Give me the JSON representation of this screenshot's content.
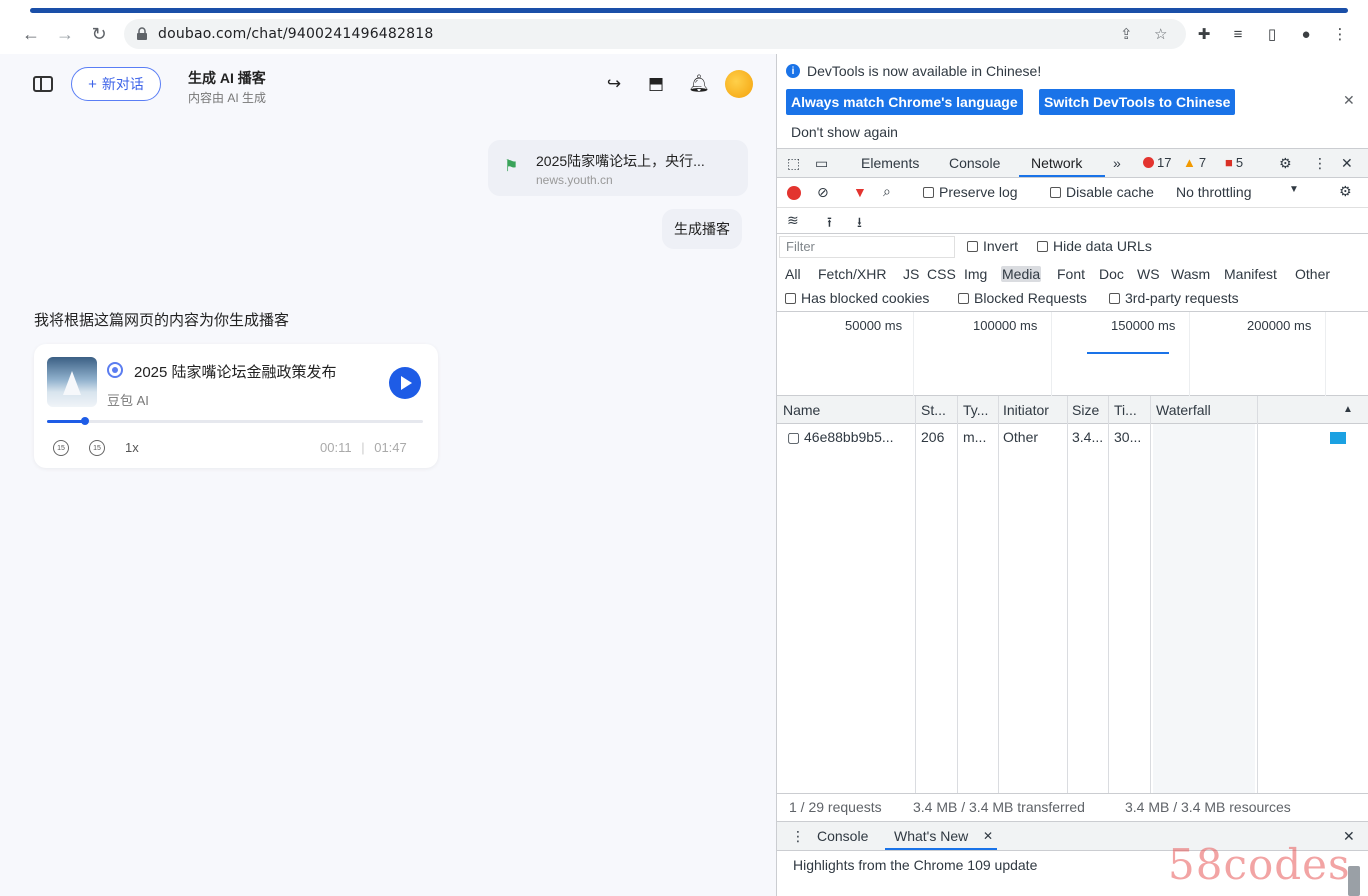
{
  "browser": {
    "url": "doubao.com/chat/9400241496482818",
    "back_label": "←",
    "forward_label": "→",
    "reload_label": "↻"
  },
  "page": {
    "new_chat_label": "新对话",
    "title": "生成 AI 播客",
    "subtitle": "内容由 AI 生成",
    "link_card": {
      "title": "2025陆家嘴论坛上，央行...",
      "source": "news.youth.cn"
    },
    "user_message": "生成播客",
    "ai_reply": "我将根据这篇网页的内容为你生成播客",
    "podcast": {
      "title": "2025 陆家嘴论坛金融政策发布",
      "author": "豆包 AI",
      "speed": "1x",
      "current_time": "00:11",
      "separator": "|",
      "duration": "01:47",
      "progress_fraction": 0.1
    }
  },
  "devtools": {
    "info_message": "DevTools is now available in Chinese!",
    "btn_match_language": "Always match Chrome's language",
    "btn_switch": "Switch DevTools to Chinese",
    "dont_show": "Don't show again",
    "tabs": [
      "Elements",
      "Console",
      "Network",
      "»"
    ],
    "active_tab": "Network",
    "errors": "17",
    "warnings": "7",
    "issues": "5",
    "preserve_log": "Preserve log",
    "disable_cache": "Disable cache",
    "throttling": "No throttling",
    "filter_placeholder": "Filter",
    "invert": "Invert",
    "hide_data_urls": "Hide data URLs",
    "types": [
      "All",
      "Fetch/XHR",
      "JS",
      "CSS",
      "Img",
      "Media",
      "Font",
      "Doc",
      "WS",
      "Wasm",
      "Manifest",
      "Other"
    ],
    "selected_type": "Media",
    "has_blocked_cookies": "Has blocked cookies",
    "blocked_requests": "Blocked Requests",
    "third_party": "3rd-party requests",
    "timeline_ticks": [
      "50000 ms",
      "100000 ms",
      "150000 ms",
      "200000 ms"
    ],
    "columns": [
      "Name",
      "St...",
      "Ty...",
      "Initiator",
      "Size",
      "Ti...",
      "Waterfall"
    ],
    "rows": [
      {
        "name": "46e88bb9b5...",
        "status": "206",
        "type": "m...",
        "initiator": "Other",
        "size": "3.4...",
        "time": "30..."
      }
    ],
    "summary_requests": "1 / 29 requests",
    "summary_transferred": "3.4 MB / 3.4 MB transferred",
    "summary_resources": "3.4 MB / 3.4 MB resources",
    "drawer_tabs": [
      "Console",
      "What's New"
    ],
    "highlights": "Highlights from the Chrome 109 update"
  },
  "watermark": "58codes",
  "colors": {
    "accent": "#1a73e8",
    "brand_blue": "#1e5ce6",
    "error": "#e3342f"
  }
}
